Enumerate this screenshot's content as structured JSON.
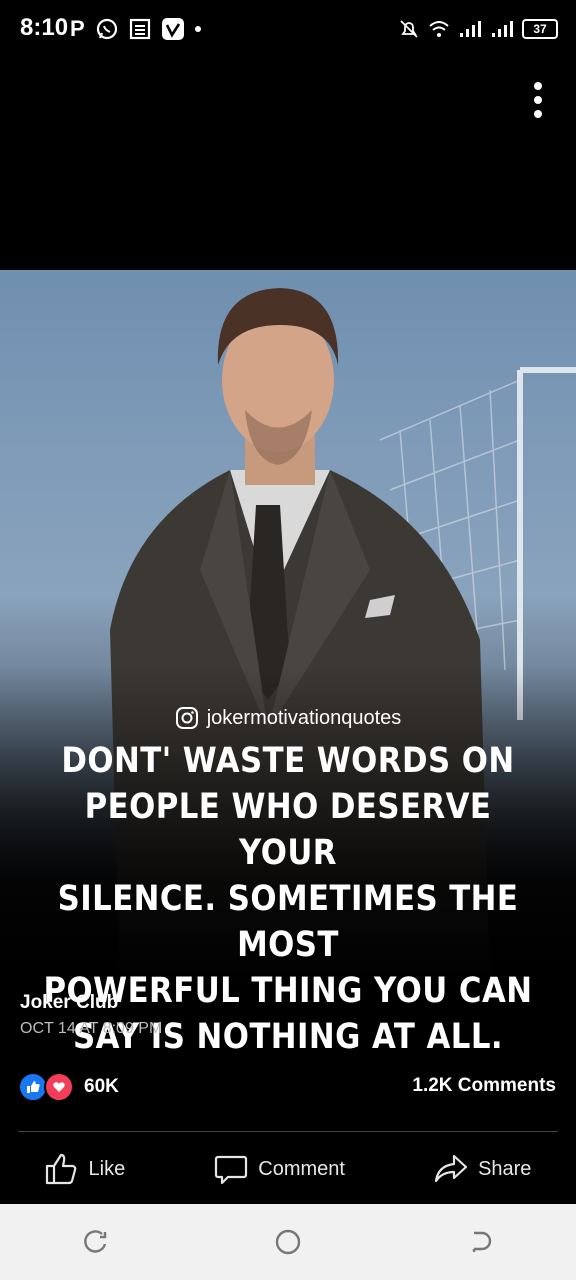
{
  "status_bar": {
    "time": "8:10",
    "battery": "37",
    "icons": [
      "p-icon",
      "whatsapp-icon",
      "news-icon",
      "vimeo-icon",
      "dot-icon",
      "mute-icon",
      "wifi-icon",
      "signal-icon",
      "signal-icon-2",
      "battery-icon"
    ]
  },
  "post": {
    "quote_handle": "jokermotivationquotes",
    "quote_text": "DONT' WASTE WORDS ON\nPEOPLE WHO DESERVE YOUR\nSILENCE. SOMETIMES THE MOST\nPOWERFUL THING YOU CAN\nSAY IS NOTHING AT ALL.",
    "author": "Joker Club",
    "timestamp": "OCT 14 AT 8:09 PM",
    "reaction_count": "60K",
    "comments_count": "1.2K Comments"
  },
  "actions": {
    "like": "Like",
    "comment": "Comment",
    "share": "Share"
  },
  "colors": {
    "like_blue": "#1877f2",
    "love_red": "#f33e58"
  }
}
